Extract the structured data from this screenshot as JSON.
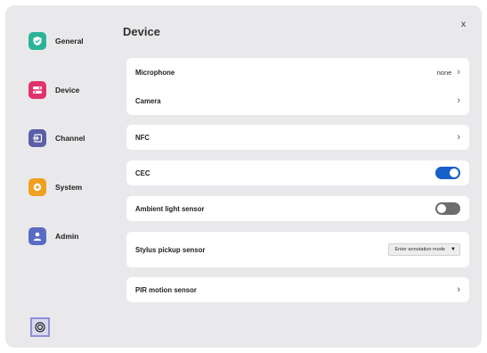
{
  "sidebar": {
    "items": [
      {
        "label": "General",
        "icon": "shield-check-icon",
        "color": "#2bb398"
      },
      {
        "label": "Device",
        "icon": "toggles-icon",
        "color": "#e0336b"
      },
      {
        "label": "Channel",
        "icon": "input-icon",
        "color": "#5b5fa8"
      },
      {
        "label": "System",
        "icon": "gear-icon",
        "color": "#f0a020"
      },
      {
        "label": "Admin",
        "icon": "person-icon",
        "color": "#5a6bc4"
      }
    ],
    "settings_icon": "settings-icon"
  },
  "header": {
    "title": "Device",
    "close_label": "x"
  },
  "rows": {
    "microphone": {
      "label": "Microphone",
      "value": "none"
    },
    "camera": {
      "label": "Camera"
    },
    "nfc": {
      "label": "NFC"
    },
    "cec": {
      "label": "CEC",
      "enabled": true
    },
    "ambient": {
      "label": "Ambient light sensor",
      "enabled": false
    },
    "stylus": {
      "label": "Stylus pickup sensor",
      "value": "Enter annotation mode"
    },
    "pir": {
      "label": "PIR motion sensor"
    }
  },
  "chevron": "›",
  "dropdown_arrow": "▼",
  "colors": {
    "toggle_on": "#1760c9",
    "toggle_off": "#6d6d6d",
    "background": "#e9e9ec"
  }
}
